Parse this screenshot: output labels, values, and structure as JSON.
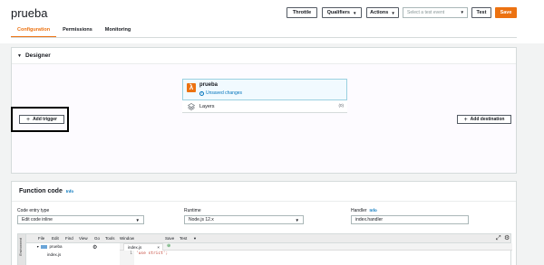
{
  "header": {
    "title": "prueba",
    "buttons": {
      "throttle": "Throttle",
      "qualifiers": "Qualifiers",
      "actions": "Actions",
      "test": "Test",
      "save": "Save"
    },
    "test_event_placeholder": "Select a test event"
  },
  "tabs": [
    {
      "label": "Configuration",
      "active": true
    },
    {
      "label": "Permissions",
      "active": false
    },
    {
      "label": "Monitoring",
      "active": false
    }
  ],
  "designer": {
    "title": "Designer",
    "function_name": "prueba",
    "status": "Unsaved changes",
    "layers_label": "Layers",
    "layers_count": "(0)",
    "add_trigger": "Add trigger",
    "add_destination": "Add destination"
  },
  "function_code": {
    "title": "Function code",
    "info": "Info",
    "entry_type": {
      "label": "Code entry type",
      "value": "Edit code inline"
    },
    "runtime": {
      "label": "Runtime",
      "value": "Node.js 12.x"
    },
    "handler": {
      "label": "Handler",
      "value": "index.handler"
    }
  },
  "editor": {
    "side_label": "Environment",
    "menu": [
      "File",
      "Edit",
      "Find",
      "View",
      "Go",
      "Tools",
      "Window",
      "Save",
      "Test"
    ],
    "tree": {
      "folder": "prueba",
      "file": "index.js"
    },
    "open_tab": "index.js",
    "line_number": "1",
    "code_line": "'use strict';"
  },
  "colors": {
    "accent": "#ec7211",
    "link": "#0073bb"
  }
}
